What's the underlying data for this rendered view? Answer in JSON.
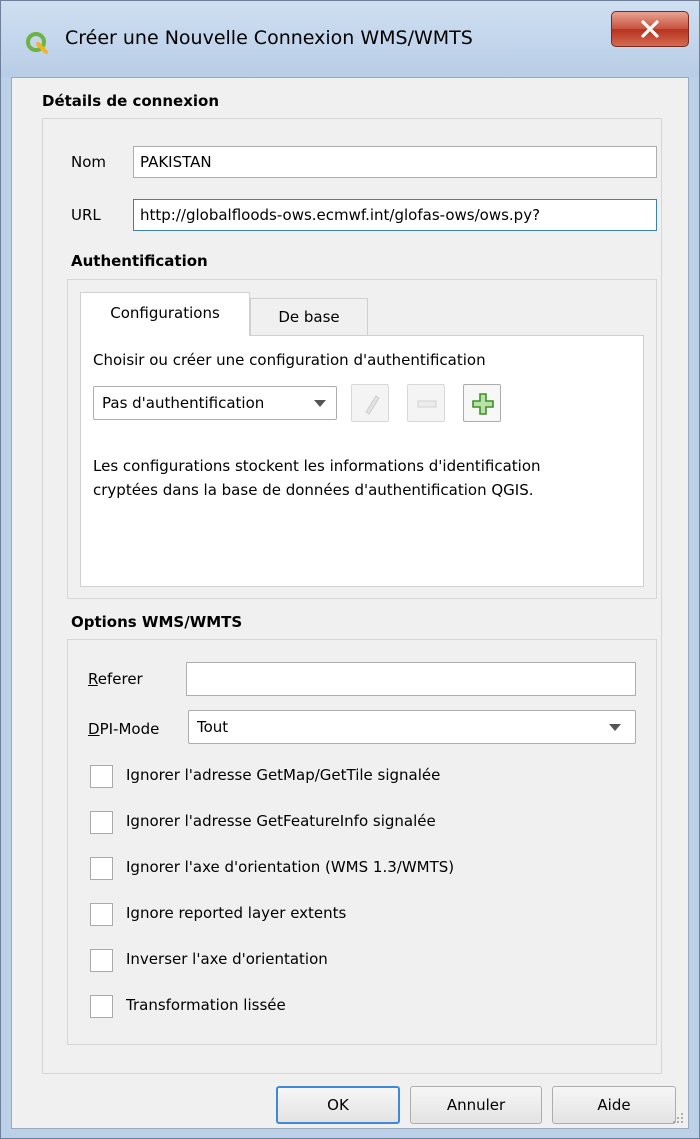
{
  "window": {
    "title": "Créer une Nouvelle Connexion WMS/WMTS"
  },
  "connection": {
    "section_title": "Détails de connexion",
    "name_label": "Nom",
    "name_value": "PAKISTAN",
    "url_label": "URL",
    "url_value": "http://globalfloods-ows.ecmwf.int/glofas-ows/ows.py?"
  },
  "auth": {
    "section_title": "Authentification",
    "tabs": [
      {
        "label": "Configurations",
        "active": true
      },
      {
        "label": "De base",
        "active": false
      }
    ],
    "choose_label": "Choisir ou créer une configuration d'authentification",
    "config_select": "Pas d'authentification",
    "description_line1": "Les configurations stockent les informations d'identification",
    "description_line2": "cryptées dans la base de données d'authentification QGIS."
  },
  "options": {
    "section_title": "Options WMS/WMTS",
    "referer_label_first": "R",
    "referer_label_rest": "eferer",
    "referer_value": "",
    "dpi_label_first": "D",
    "dpi_label_rest": "PI-Mode",
    "dpi_value": "Tout",
    "checkboxes": [
      {
        "label": "Ignorer l'adresse GetMap/GetTile signalée",
        "checked": false
      },
      {
        "label": "Ignorer l'adresse GetFeatureInfo signalée",
        "checked": false
      },
      {
        "label": "Ignorer l'axe d'orientation (WMS 1.3/WMTS)",
        "checked": false
      },
      {
        "label": "Ignore reported layer extents",
        "checked": false
      },
      {
        "label": "Inverser l'axe d'orientation",
        "checked": false
      },
      {
        "label": "Transformation lissée",
        "checked": false
      }
    ]
  },
  "buttons": {
    "ok": "OK",
    "cancel": "Annuler",
    "help": "Aide"
  },
  "colors": {
    "accent": "#3c8ad8",
    "qgis_green": "#6cb33f",
    "close_red": "#c8513d"
  }
}
